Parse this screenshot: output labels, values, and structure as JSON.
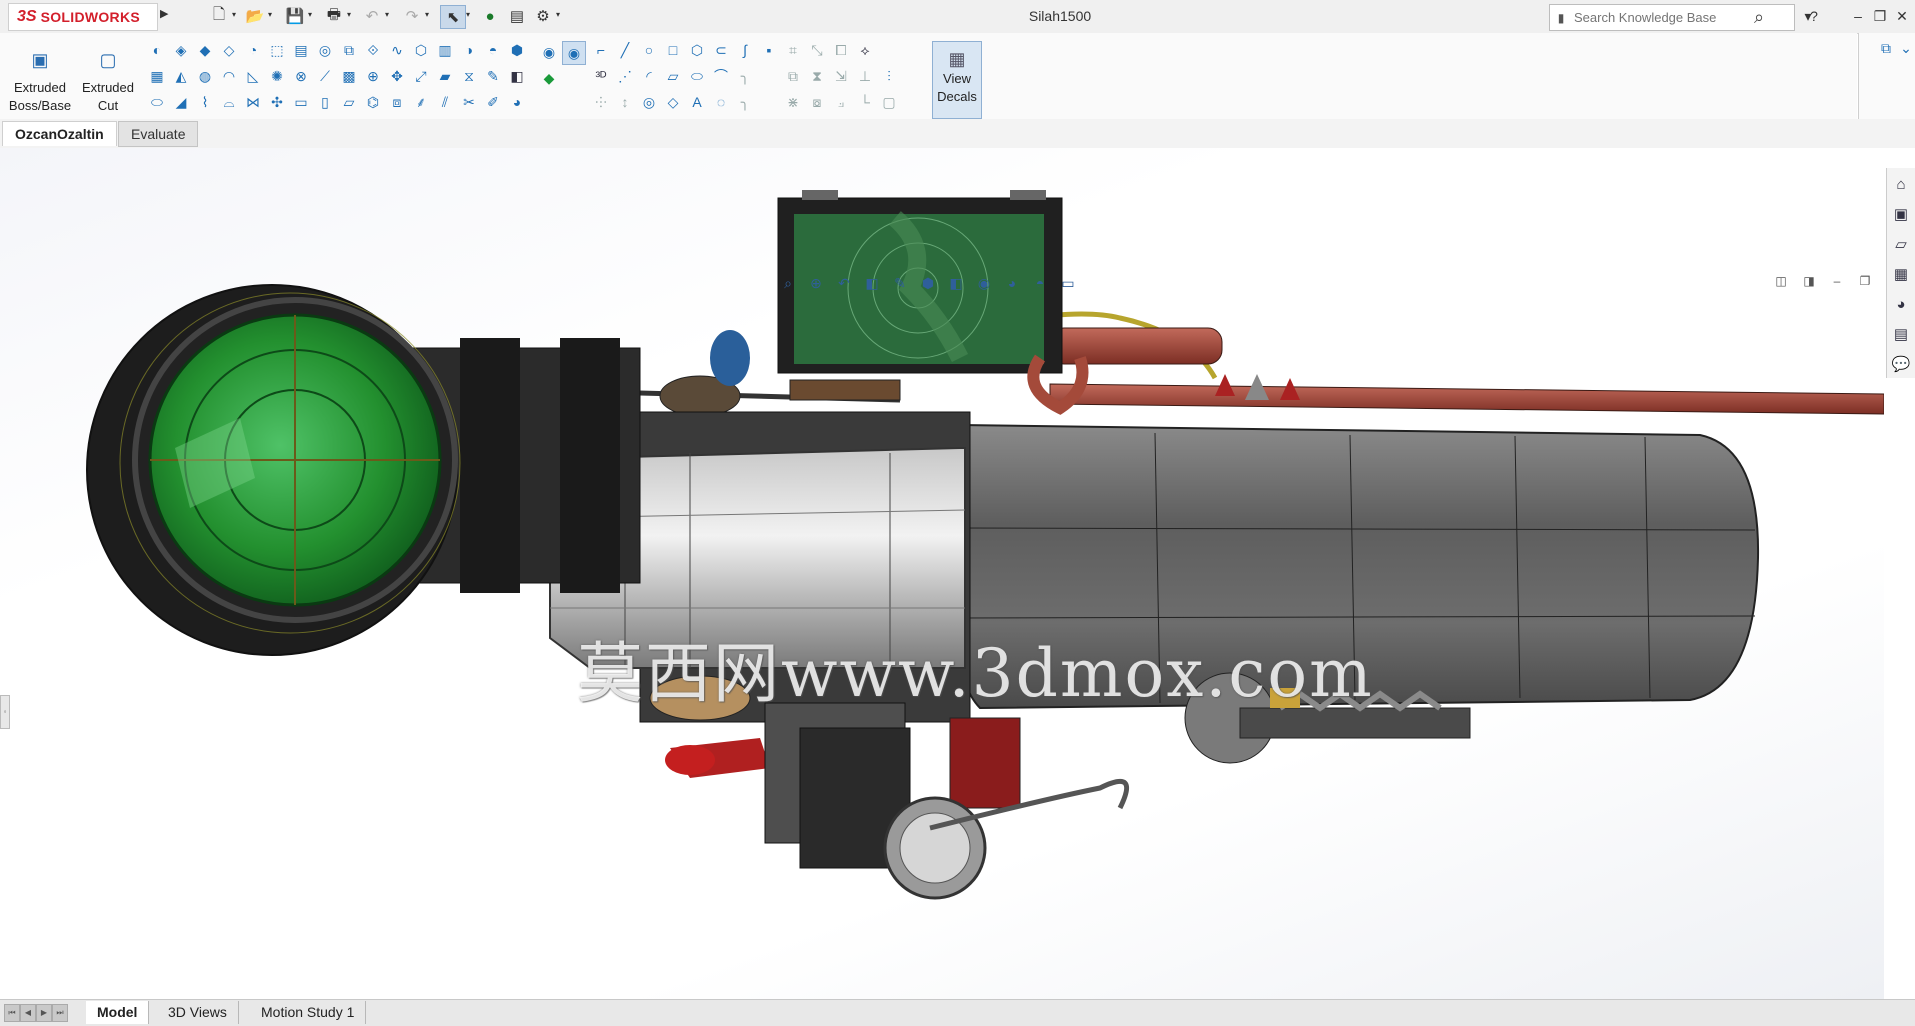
{
  "app": {
    "brand_ds": "3S",
    "brand_name": "SOLIDWORKS",
    "document_title": "Silah1500"
  },
  "search": {
    "placeholder": "Search Knowledge Base"
  },
  "window_controls": {
    "help": "?",
    "minimize": "–",
    "restore": "❐",
    "close": "✕"
  },
  "command_manager": {
    "extruded_boss_line1": "Extruded",
    "extruded_boss_line2": "Boss/Base",
    "extruded_cut_line1": "Extruded",
    "extruded_cut_line2": "Cut",
    "view_decals_line1": "View",
    "view_decals_line2": "Decals"
  },
  "tabs": [
    {
      "label": "OzcanOzaltin",
      "active": true
    },
    {
      "label": "Evaluate",
      "active": false
    }
  ],
  "watermark": "莫西网www.3dmox.com",
  "bottom_tabs": [
    {
      "label": "Model",
      "active": true
    },
    {
      "label": "3D Views",
      "active": false
    },
    {
      "label": "Motion Study 1",
      "active": false
    }
  ],
  "colors": {
    "brand_red": "#d31f2b",
    "scope_green": "#2fa84a",
    "radar_green": "#2b6b3c",
    "barrel_red": "#b04a3a",
    "body_grey": "#6e6e6e"
  },
  "icons": {
    "qa_new": "new-document-icon",
    "qa_open": "open-icon",
    "qa_save": "save-icon",
    "qa_print": "print-icon",
    "qa_undo": "undo-icon",
    "qa_redo": "redo-icon",
    "qa_select": "select-cursor-icon",
    "qa_rebuild": "traffic-light-icon",
    "qa_file_props": "file-properties-icon",
    "qa_options": "gear-icon"
  }
}
